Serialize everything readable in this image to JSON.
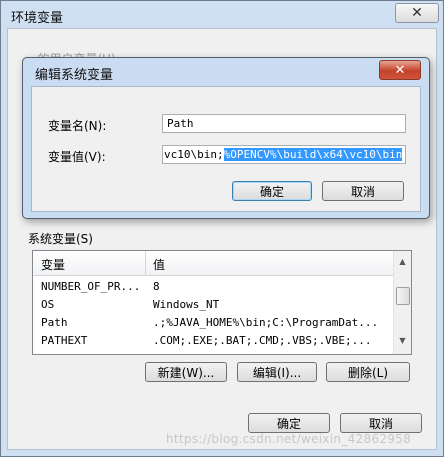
{
  "outer_window": {
    "title": "环境变量",
    "partial_hint": "...的用户变量(U)",
    "close_glyph": "✕"
  },
  "system_vars": {
    "group_label": "系统变量(S)",
    "columns": [
      "变量",
      "值"
    ],
    "rows": [
      {
        "name": "NUMBER_OF_PR...",
        "value": "8"
      },
      {
        "name": "OS",
        "value": "Windows_NT"
      },
      {
        "name": "Path",
        "value": ".;%JAVA_HOME%\\bin;C:\\ProgramDat..."
      },
      {
        "name": "PATHEXT",
        "value": ".COM;.EXE;.BAT;.CMD;.VBS;.VBE;..."
      }
    ],
    "buttons": {
      "new": "新建(W)...",
      "edit": "编辑(I)...",
      "delete": "删除(L)"
    }
  },
  "outer_buttons": {
    "ok": "确定",
    "cancel": "取消"
  },
  "dialog": {
    "title": "编辑系统变量",
    "close_glyph": "✕",
    "name_label": "变量名(N):",
    "name_value": "Path",
    "value_label": "变量值(V):",
    "value_prefix": "vc10\\bin;",
    "value_selected": "%OPENCV%\\build\\x64\\vc10\\bin",
    "ok": "确定",
    "cancel": "取消"
  },
  "watermark": "https://blog.csdn.net/weixin_42862958",
  "colors": {
    "selection": "#3399ff",
    "title_bar": "#c9dcf1",
    "close_red": "#c4432b"
  }
}
